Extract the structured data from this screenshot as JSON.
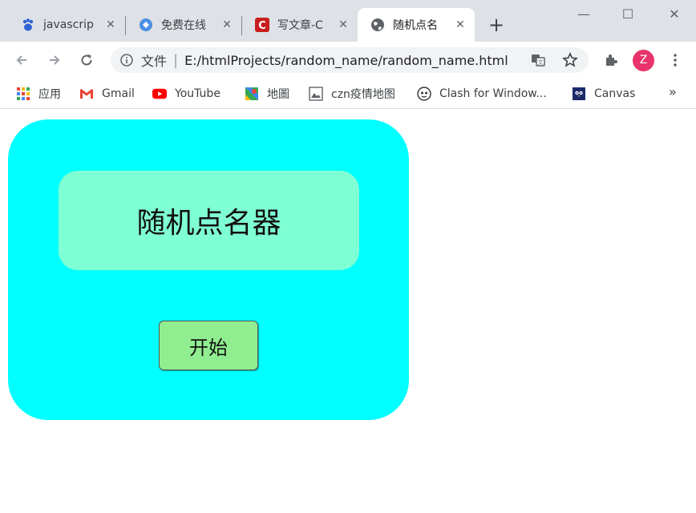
{
  "browser": {
    "tabs": [
      {
        "title": "javascrip",
        "icon": "baidu-paw-icon"
      },
      {
        "title": "免费在线",
        "icon": "app-icon"
      },
      {
        "title": "写文章-C",
        "icon": "csdn-icon"
      },
      {
        "title": "随机点名",
        "icon": "globe-icon",
        "active": true
      }
    ],
    "address": {
      "label": "文件",
      "url": "E:/htmlProjects/random_name/random_name.html"
    },
    "avatar_letter": "Z",
    "bookmarks": [
      {
        "label": "应用",
        "icon": "apps-grid-icon"
      },
      {
        "label": "Gmail",
        "icon": "gmail-icon"
      },
      {
        "label": "YouTube",
        "icon": "youtube-icon"
      },
      {
        "label": "地圖",
        "icon": "maps-icon"
      },
      {
        "label": "czn疫情地图",
        "icon": "image-icon"
      },
      {
        "label": "Clash for Window...",
        "icon": "clash-icon"
      },
      {
        "label": "Canvas",
        "icon": "canvas-owl-icon"
      }
    ],
    "bookmarks_more": "»"
  },
  "page": {
    "title": "随机点名器",
    "start_button": "开始"
  },
  "colors": {
    "card": "#00ffff",
    "display": "#7fffd4",
    "button": "#90ee90"
  }
}
